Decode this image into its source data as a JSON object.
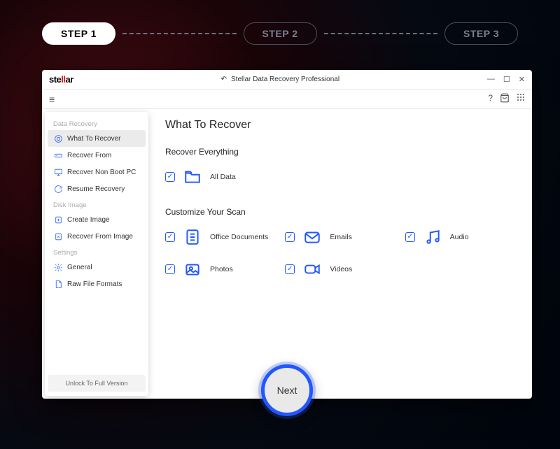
{
  "stepper": {
    "steps": [
      "STEP 1",
      "STEP 2",
      "STEP 3"
    ],
    "active_index": 0
  },
  "window": {
    "logo": "stellar",
    "title": "Stellar Data Recovery Professional"
  },
  "sidebar": {
    "groups": [
      {
        "label": "Data Recovery",
        "items": [
          {
            "label": "What To Recover",
            "active": true
          },
          {
            "label": "Recover From"
          },
          {
            "label": "Recover Non Boot PC"
          },
          {
            "label": "Resume Recovery"
          }
        ]
      },
      {
        "label": "Disk Image",
        "items": [
          {
            "label": "Create Image"
          },
          {
            "label": "Recover From Image"
          }
        ]
      },
      {
        "label": "Settings",
        "items": [
          {
            "label": "General"
          },
          {
            "label": "Raw File Formats"
          }
        ]
      }
    ],
    "unlock_label": "Unlock To Full Version"
  },
  "main": {
    "heading": "What To Recover",
    "section1": {
      "title": "Recover Everything",
      "items": [
        {
          "label": "All Data"
        }
      ]
    },
    "section2": {
      "title": "Customize Your Scan",
      "items": [
        {
          "label": "Office Documents"
        },
        {
          "label": "Emails"
        },
        {
          "label": "Audio"
        },
        {
          "label": "Photos"
        },
        {
          "label": "Videos"
        }
      ]
    },
    "next_label": "Next"
  }
}
